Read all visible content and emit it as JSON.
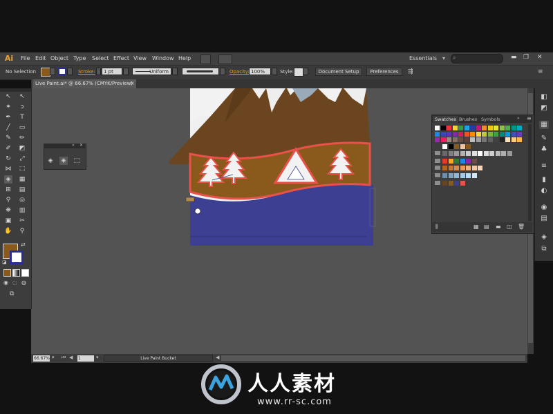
{
  "app": {
    "logo": "Ai"
  },
  "menu": [
    "File",
    "Edit",
    "Object",
    "Type",
    "Select",
    "Effect",
    "View",
    "Window",
    "Help"
  ],
  "workspace": {
    "label": "Essentials",
    "search_placeholder": ""
  },
  "control_bar": {
    "selection": "No Selection",
    "stroke_label": "Stroke:",
    "stroke_value": "1 pt",
    "profile": "Uniform",
    "opacity_label": "Opacity:",
    "opacity_value": "100%",
    "style_label": "Style:",
    "document_setup": "Document Setup",
    "preferences": "Preferences"
  },
  "document": {
    "tab_title": "Live Paint.ai* @ 66.67% (CMYK/Preview)",
    "close": "×"
  },
  "status": {
    "zoom": "66.67%",
    "page": "1",
    "tool": "Live Paint Bucket"
  },
  "panels": {
    "swatches_tabs": [
      "Swatches",
      "Brushes",
      "Symbols"
    ]
  },
  "colors": {
    "fill": "#8a5a1c",
    "stroke": "#2b2d90",
    "mountain": "#6b4520",
    "snow": "#f2f2f2",
    "banner": "#8a5a1c",
    "banner_outline": "#e8524a",
    "water": "#3c3f92"
  },
  "watermark": {
    "text": "人人素材",
    "url": "www.rr-sc.com"
  }
}
